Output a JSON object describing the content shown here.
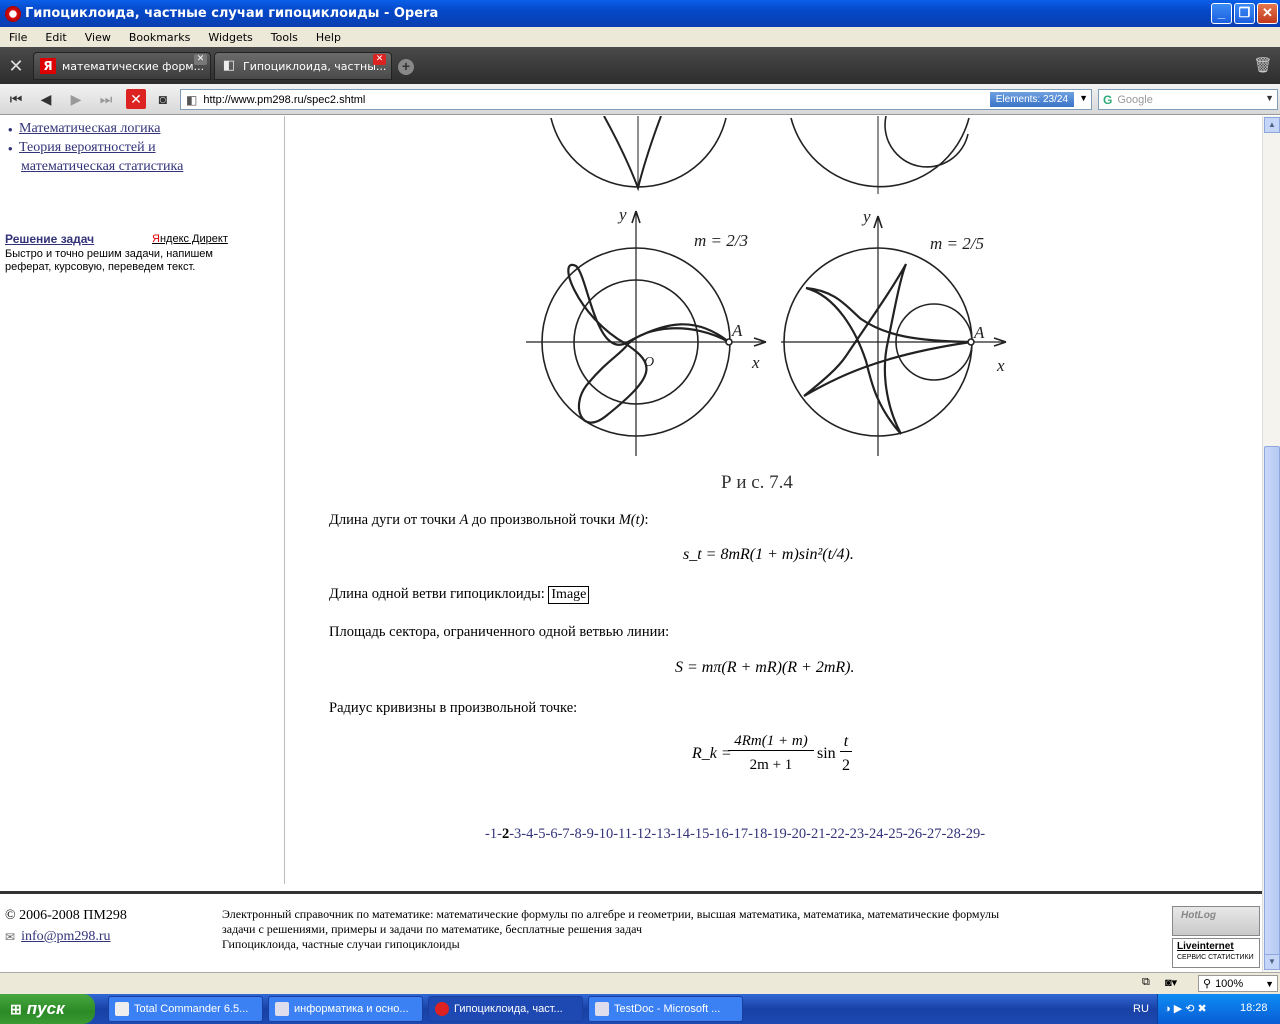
{
  "window": {
    "title": "Гипоциклоида, частные случаи гипоциклоиды - Opera"
  },
  "menu": [
    "File",
    "Edit",
    "View",
    "Bookmarks",
    "Widgets",
    "Tools",
    "Help"
  ],
  "tabs": [
    {
      "label": "математические форм...",
      "active": false
    },
    {
      "label": "Гипоциклоида, частны...",
      "active": true
    }
  ],
  "address": {
    "url": "http://www.pm298.ru/spec2.shtml",
    "elements": "Elements:  23/24",
    "search_placeholder": "Google"
  },
  "sidebar": {
    "links": [
      "Математическая логика",
      "Теория вероятностей и",
      "математическая статистика"
    ],
    "ad_title": "Решение задач",
    "ad_brand_first": "Я",
    "ad_brand_rest": "ндекс Директ",
    "ad_text": "Быстро и точно решим задачи, напишем реферат, курсовую, переведем текст."
  },
  "figure": {
    "label_m1": "m = 2/3",
    "label_m2": "m = 2/5",
    "axis_y": "y",
    "axis_x": "x",
    "point_a": "A",
    "origin": "O",
    "caption": "Р и с.   7.4"
  },
  "content": {
    "p1": "Длина дуги от точки ",
    "p1_a": "A",
    "p1_mid": " до произвольной точки ",
    "p1_m": "M(t)",
    "p1_end": ":",
    "f1": "s_t = 8mR(1 + m)sin²(t/4).",
    "p2": "Длина одной ветви гипоциклоиды: ",
    "img_alt": "Image",
    "p3": "Площадь сектора, ограниченного одной ветвью линии:",
    "f2": "S = mπ(R + mR)(R + 2mR).",
    "p4": "Радиус кривизны в произвольной точке:",
    "f3_lhs": "R_k =",
    "f3_num": "4Rm(1 + m)",
    "f3_den": "2m + 1",
    "f3_sin": "sin",
    "f3_t": "t",
    "f3_2": "2"
  },
  "pagination": {
    "pages": [
      "1",
      "2",
      "3",
      "4",
      "5",
      "6",
      "7",
      "8",
      "9",
      "10",
      "11",
      "12",
      "13",
      "14",
      "15",
      "16",
      "17",
      "18",
      "19",
      "20",
      "21",
      "22",
      "23",
      "24",
      "25",
      "26",
      "27",
      "28",
      "29"
    ],
    "current": "2"
  },
  "footer": {
    "copyright": "© 2006-2008 ПМ298",
    "email": "info@pm298.ru",
    "desc_line1": "Электронный справочник по математике: математические формулы по алгебре и геометрии, высшая математика, математика, математические формулы",
    "desc_line2": "задачи с решениями, примеры и задачи по математике, бесплатные решения задач",
    "desc_line3": "Гипоциклоида, частные случаи гипоциклоиды",
    "counter1": "HotLog",
    "counter2_title": "Liveinternet",
    "counter2_sub": "СЕРВИС  СТАТИСТИКИ"
  },
  "status": {
    "zoom": "100%"
  },
  "taskbar": {
    "start": "пуск",
    "tasks": [
      {
        "label": "Total Commander 6.5...",
        "active": false
      },
      {
        "label": "информатика и осно...",
        "active": false
      },
      {
        "label": "Гипоциклоида, част...",
        "active": true
      },
      {
        "label": "TestDoc - Microsoft ...",
        "active": false
      }
    ],
    "lang": "RU",
    "clock": "18:28"
  }
}
